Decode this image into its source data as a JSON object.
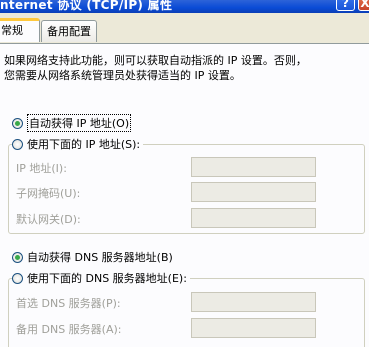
{
  "window": {
    "title": "nternet 协议 (TCP/IP) 属性",
    "help_label": "?",
    "close_label": "X"
  },
  "tabs": [
    {
      "label": "常规",
      "active": true
    },
    {
      "label": "备用配置",
      "active": false
    }
  ],
  "description": {
    "line1": "如果网络支持此功能，则可以获取自动指派的 IP 设置。否则，",
    "line2": "您需要从网络系统管理员处获得适当的 IP 设置。"
  },
  "ip_options": {
    "auto": {
      "label": "自动获得 IP 地址(O)",
      "checked": true
    },
    "manual": {
      "label": "使用下面的 IP 地址(S):",
      "checked": false
    }
  },
  "ip_fields": [
    {
      "label": "IP 地址(I):",
      "value": ""
    },
    {
      "label": "子网掩码(U):",
      "value": ""
    },
    {
      "label": "默认网关(D):",
      "value": ""
    }
  ],
  "dns_options": {
    "auto": {
      "label": "自动获得 DNS 服务器地址(B)",
      "checked": true
    },
    "manual": {
      "label": "使用下面的 DNS 服务器地址(E):",
      "checked": false
    }
  },
  "dns_fields": [
    {
      "label": "首选 DNS 服务器(P):",
      "value": ""
    },
    {
      "label": "备用 DNS 服务器(A):",
      "value": ""
    }
  ],
  "colors": {
    "titlebar": "#0a4bd6",
    "tab_highlight": "#ffc83c",
    "radio_dot": "#39a94a",
    "disabled_text": "#a0a09a"
  }
}
